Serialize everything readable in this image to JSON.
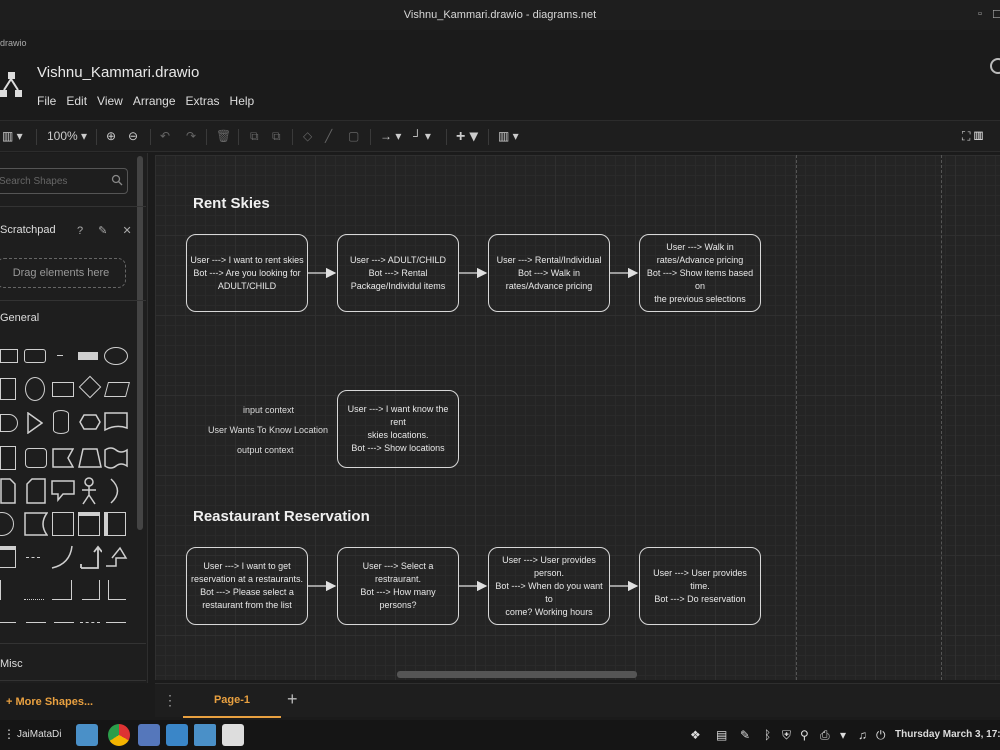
{
  "window": {
    "title": "Vishnu_Kammari.drawio - diagrams.net",
    "app_name": "drawio",
    "controls": [
      "▫",
      "☐"
    ]
  },
  "header": {
    "document_title": "Vishnu_Kammari.drawio",
    "menu": [
      "File",
      "Edit",
      "View",
      "Arrange",
      "Extras",
      "Help"
    ]
  },
  "toolbar": {
    "zoom": "100%"
  },
  "sidebar": {
    "search_placeholder": "Search Shapes",
    "scratchpad_label": "Scratchpad",
    "scratchpad_controls": "? ✎ ✕",
    "dropzone_label": "Drag elements here",
    "general_label": "General",
    "misc_label": "Misc",
    "more_shapes_label": "+ More Shapes..."
  },
  "diagram": {
    "section1_title": "Rent Skies",
    "section2_title": "Reastaurant Reservation",
    "rent_nodes": [
      "User ---> I want to rent skies\nBot ---> Are you looking for\nADULT/CHILD",
      "User ---> ADULT/CHILD\nBot ---> Rental\nPackage/Individul items",
      "User ---> Rental/Individual\nBot ---> Walk in\nrates/Advance pricing",
      "User ---> Walk in\nrates/Advance pricing\nBot ---> Show items based on\nthe previous selections"
    ],
    "context_labels": [
      "input context",
      "User Wants To Know Location",
      "output context"
    ],
    "location_node": "User ---> I want know the rent\nskies locations.\nBot ---> Show locations",
    "restaurant_nodes": [
      "User ---> I want to get\nreservation at a restaurants.\nBot ---> Please select a\nrestaurant from the list",
      "User ---> Select a restraurant.\nBot ---> How many persons?",
      "User ---> User provides\nperson.\nBot ---> When do you want to\ncome? Working hours",
      "User ---> User provides time.\nBot ---> Do reservation"
    ]
  },
  "pages": {
    "active_tab": "Page-1",
    "add_label": "+"
  },
  "taskbar": {
    "user": "JaiMataDi",
    "clock": "Thursday March 3, 17:"
  }
}
